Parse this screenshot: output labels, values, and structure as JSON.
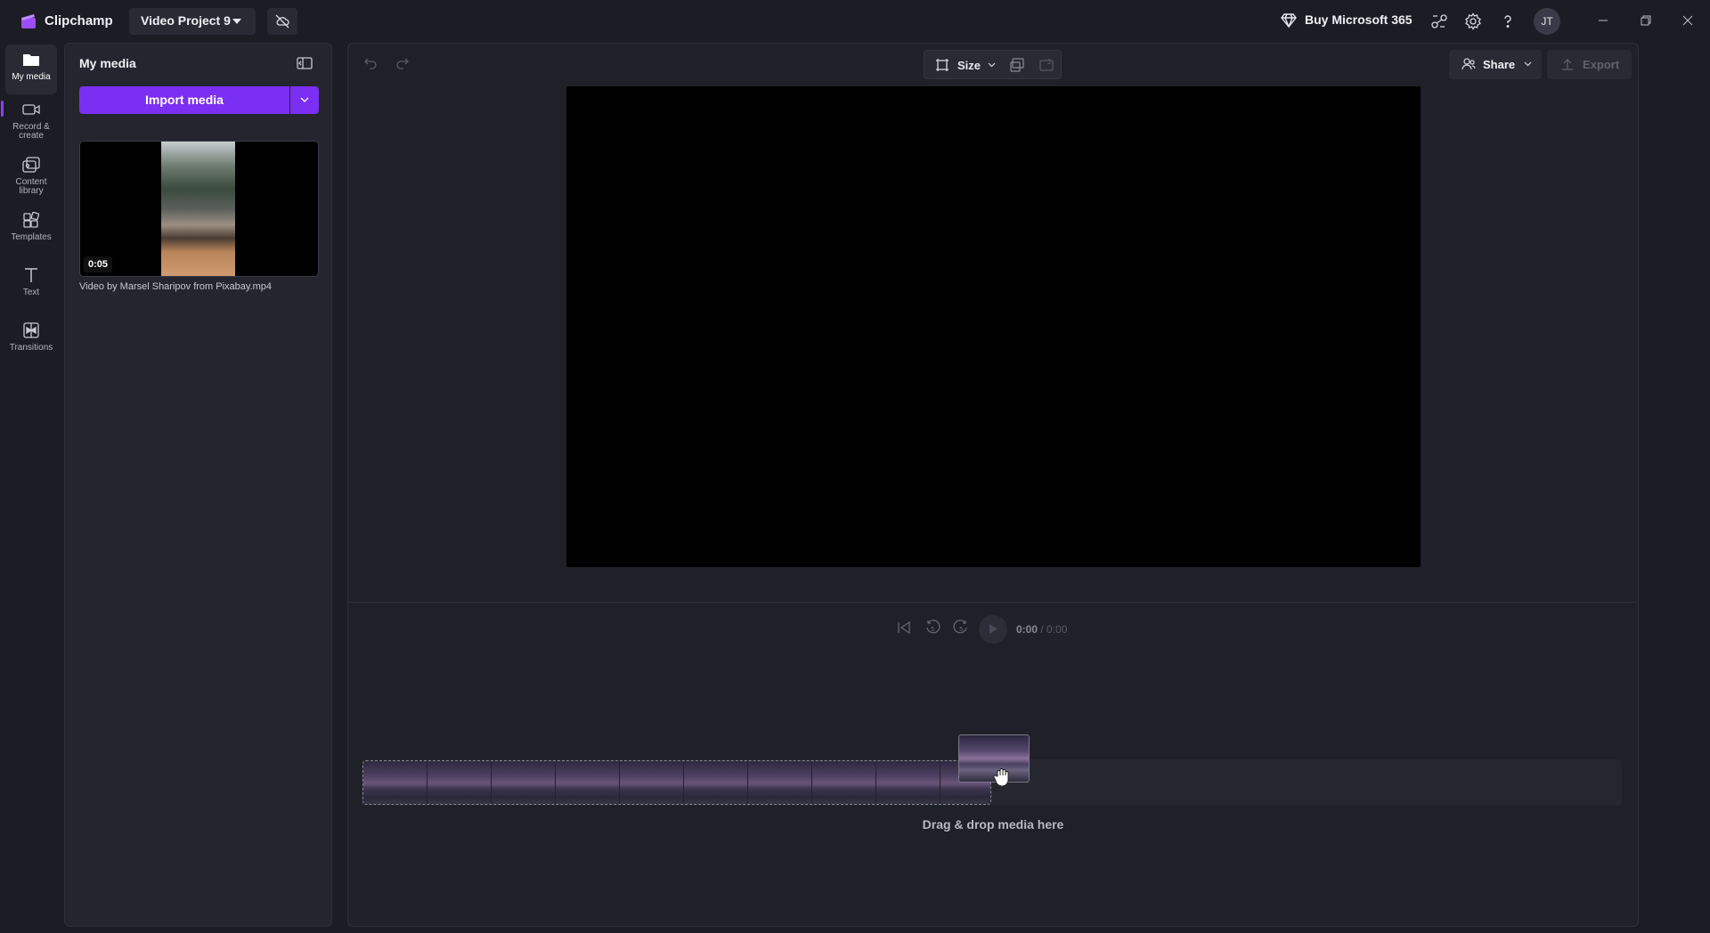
{
  "app": {
    "name": "Clipchamp",
    "project_title": "Video Project 9"
  },
  "titlebar": {
    "buy_label": "Buy Microsoft 365",
    "avatar_initials": "JT"
  },
  "leftnav": {
    "items": [
      {
        "label": "My media",
        "icon": "folder-icon"
      },
      {
        "label": "Record & create",
        "icon": "camera-icon"
      },
      {
        "label": "Content library",
        "icon": "library-icon"
      },
      {
        "label": "Templates",
        "icon": "templates-icon"
      },
      {
        "label": "Text",
        "icon": "text-icon"
      },
      {
        "label": "Transitions",
        "icon": "transitions-icon"
      }
    ]
  },
  "media_panel": {
    "title": "My media",
    "import_label": "Import media",
    "items": [
      {
        "duration": "0:05",
        "name": "Video by Marsel Sharipov from Pixabay.mp4"
      }
    ]
  },
  "editor": {
    "size_label": "Size",
    "share_label": "Share",
    "export_label": "Export",
    "timecode": {
      "current": "0:00",
      "total": "/ 0:00"
    },
    "skip_seconds": "5",
    "timeline_hint": "Drag & drop media here"
  },
  "colors": {
    "accent": "#7b2ff2",
    "background": "#1c1c24",
    "panel": "#252530"
  }
}
